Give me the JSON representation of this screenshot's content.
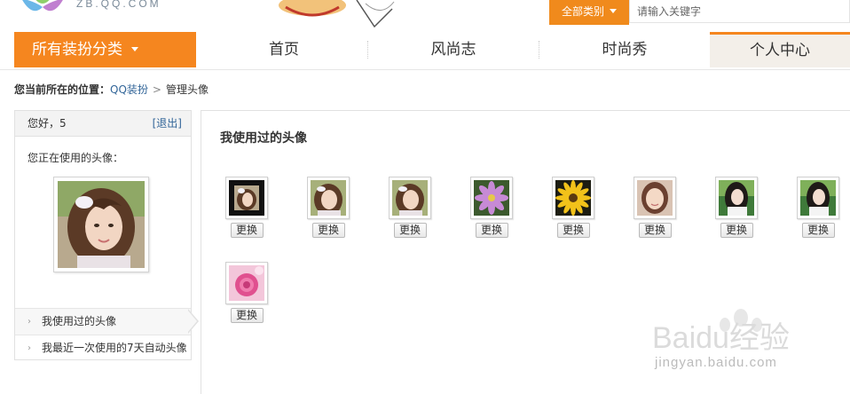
{
  "header": {
    "logo_text": "ZB.QQ.COM",
    "category_button": "全部类别",
    "search_placeholder": "请输入关键字"
  },
  "nav": {
    "all_categories": "所有装扮分类",
    "items": [
      "首页",
      "风尚志",
      "时尚秀",
      "个人中心"
    ],
    "active_index": 3,
    "accent_color": "#f5861f"
  },
  "breadcrumb": {
    "label": "您当前所在的位置：",
    "items": [
      "QQ装扮",
      "管理头像"
    ]
  },
  "sidebar": {
    "greeting": "您好，5",
    "logout": "[退出]",
    "current_avatar_label": "您正在使用的头像：",
    "menu": [
      "我使用过的头像",
      "我最近一次使用的7天自动头像"
    ],
    "active_menu_index": 0
  },
  "main": {
    "title": "我使用过的头像",
    "change_label": "更换",
    "avatars": [
      {
        "kind": "girl-framed"
      },
      {
        "kind": "girl"
      },
      {
        "kind": "girl"
      },
      {
        "kind": "pink-flower"
      },
      {
        "kind": "yellow-flower"
      },
      {
        "kind": "girl-smile"
      },
      {
        "kind": "girl-dark-hair"
      },
      {
        "kind": "girl-dark-hair"
      },
      {
        "kind": "pink-rose"
      }
    ]
  },
  "watermark": {
    "brand": "Baidu经验",
    "url": "jingyan.baidu.com"
  }
}
